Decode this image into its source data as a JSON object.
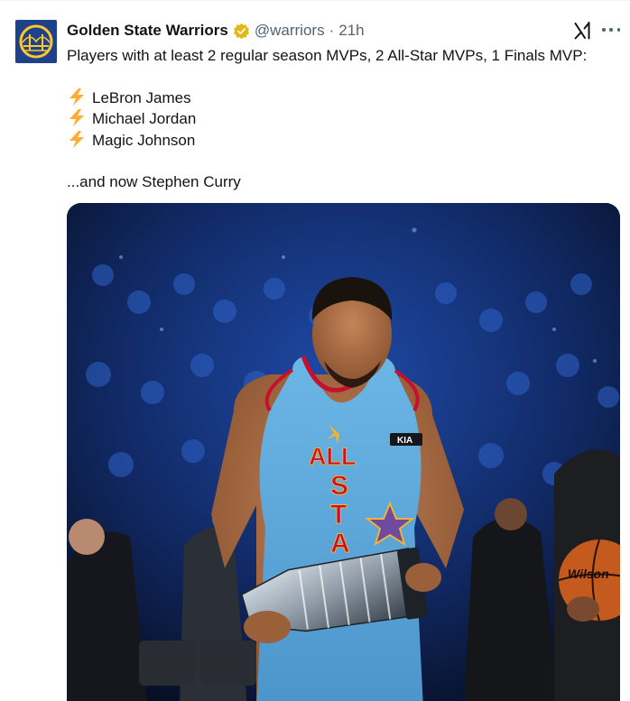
{
  "author": {
    "display_name": "Golden State Warriors",
    "handle": "@warriors",
    "separator": "·",
    "time": "21h",
    "avatar_icon": "warriors-bridge-logo",
    "verified_icon": "gold-verified-badge"
  },
  "tweet": {
    "intro": "Players with at least 2 regular season MVPs, 2 All-Star MVPs, 1 Finals MVP:",
    "list_icon": "lightning-bolt-emoji",
    "players": [
      "LeBron James",
      "Michael Jordan",
      "Magic Johnson"
    ],
    "outro": "...and now Stephen Curry"
  },
  "actions": {
    "grok_icon": "grok-icon",
    "more_icon": "more-options-icon"
  },
  "media": {
    "jersey_lettering": "ALL STA",
    "sponsor_logo_text": "KIA",
    "ball_brand": "Wilson"
  },
  "colors": {
    "brand_blue": "#1d428a",
    "brand_gold": "#ffc72c",
    "text_primary": "#0f1419",
    "text_secondary": "#536471",
    "jersey_blue": "#5fa8d8",
    "jersey_red": "#c8102e"
  }
}
